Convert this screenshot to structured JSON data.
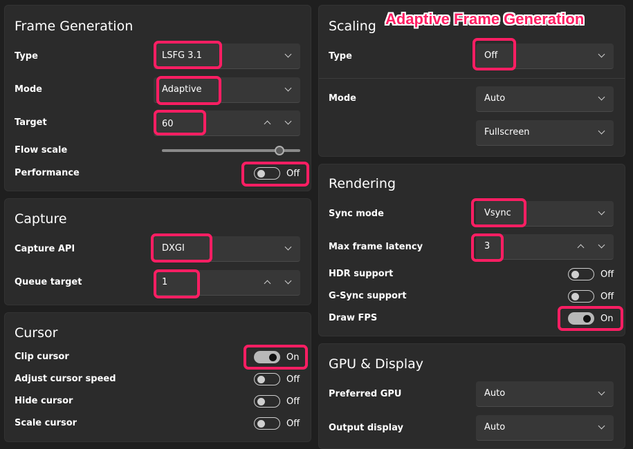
{
  "overlay_title": "Adaptive Frame Generation",
  "frame_generation": {
    "title": "Frame Generation",
    "type_label": "Type",
    "type_value": "LSFG 3.1",
    "mode_label": "Mode",
    "mode_value": "Adaptive",
    "target_label": "Target",
    "target_value": "60",
    "flow_scale_label": "Flow scale",
    "flow_scale_value": 0.85,
    "performance_label": "Performance",
    "performance_state": "Off"
  },
  "capture": {
    "title": "Capture",
    "api_label": "Capture API",
    "api_value": "DXGI",
    "queue_label": "Queue target",
    "queue_value": "1"
  },
  "cursor": {
    "title": "Cursor",
    "clip_label": "Clip cursor",
    "clip_state": "On",
    "adjust_label": "Adjust cursor speed",
    "adjust_state": "Off",
    "hide_label": "Hide cursor",
    "hide_state": "Off",
    "scale_label": "Scale cursor",
    "scale_state": "Off"
  },
  "scaling": {
    "title": "Scaling",
    "type_label": "Type",
    "type_value": "Off",
    "mode_label": "Mode",
    "mode_value": "Auto",
    "mode_value2": "Fullscreen"
  },
  "rendering": {
    "title": "Rendering",
    "sync_label": "Sync mode",
    "sync_value": "Vsync",
    "latency_label": "Max frame latency",
    "latency_value": "3",
    "hdr_label": "HDR support",
    "hdr_state": "Off",
    "gsync_label": "G-Sync support",
    "gsync_state": "Off",
    "fps_label": "Draw FPS",
    "fps_state": "On"
  },
  "gpu_display": {
    "title": "GPU & Display",
    "gpu_label": "Preferred GPU",
    "gpu_value": "Auto",
    "output_label": "Output display",
    "output_value": "Auto"
  },
  "colors": {
    "highlight": "#ff1e63",
    "card_bg": "#2b2b2b",
    "page_bg": "#1f1f1f"
  }
}
